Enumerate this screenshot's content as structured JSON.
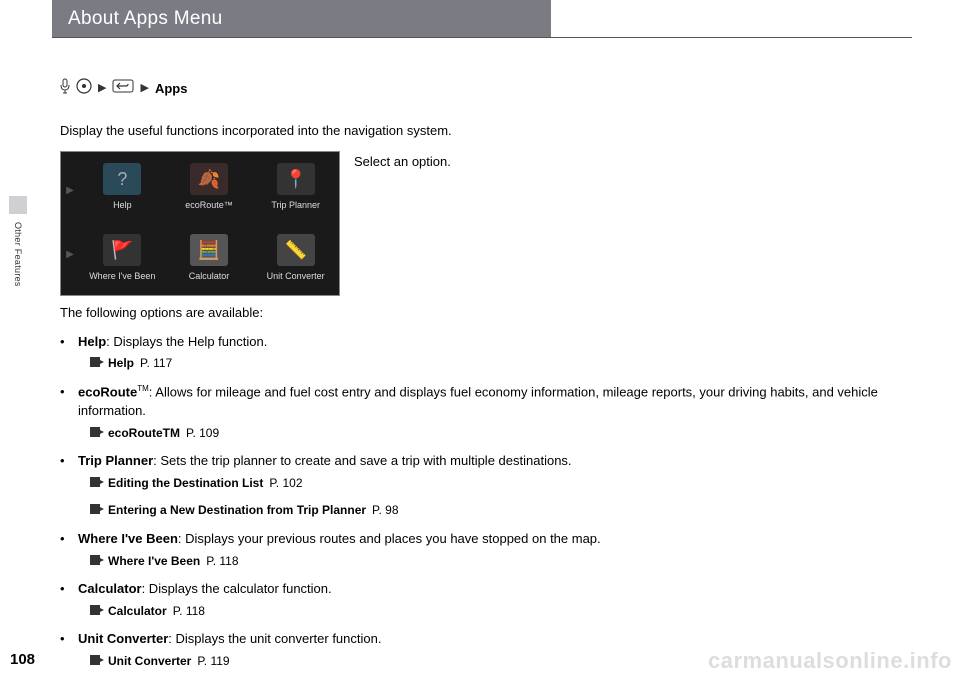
{
  "header": {
    "title": "About Apps Menu"
  },
  "breadcrumb": {
    "label": "Apps"
  },
  "intro": "Display the useful functions incorporated into the navigation system.",
  "selectText": "Select an option.",
  "navScreen": {
    "items": [
      {
        "label": "Help"
      },
      {
        "label": "ecoRoute™"
      },
      {
        "label": "Trip Planner"
      },
      {
        "label": "Where I've Been"
      },
      {
        "label": "Calculator"
      },
      {
        "label": "Unit Converter"
      }
    ]
  },
  "optionsIntro": "The following options are available:",
  "options": [
    {
      "title": "Help",
      "desc": ": Displays the Help function.",
      "refs": [
        {
          "text": "Help",
          "page": "P. 117"
        }
      ]
    },
    {
      "title": "ecoRoute",
      "titleSup": "TM",
      "desc": ": Allows for mileage and fuel cost entry and displays fuel economy information, mileage reports, your driving habits, and vehicle information.",
      "refs": [
        {
          "text": "ecoRouteTM",
          "page": "P. 109"
        }
      ]
    },
    {
      "title": "Trip Planner",
      "desc": ": Sets the trip planner to create and save a trip with multiple destinations.",
      "refs": [
        {
          "text": "Editing the Destination List",
          "page": "P. 102"
        },
        {
          "text": "Entering a New Destination from Trip Planner",
          "page": "P. 98"
        }
      ]
    },
    {
      "title": "Where I've Been",
      "desc": ": Displays your previous routes and places you have stopped on the map.",
      "refs": [
        {
          "text": "Where I've Been",
          "page": "P. 118"
        }
      ]
    },
    {
      "title": "Calculator",
      "desc": ": Displays the calculator function.",
      "refs": [
        {
          "text": "Calculator",
          "page": "P. 118"
        }
      ]
    },
    {
      "title": "Unit Converter",
      "desc": ": Displays the unit converter function.",
      "refs": [
        {
          "text": "Unit Converter",
          "page": "P. 119"
        }
      ]
    }
  ],
  "sidebar": {
    "label": "Other Features"
  },
  "pageNumber": "108",
  "watermark": "carmanualsonline.info"
}
